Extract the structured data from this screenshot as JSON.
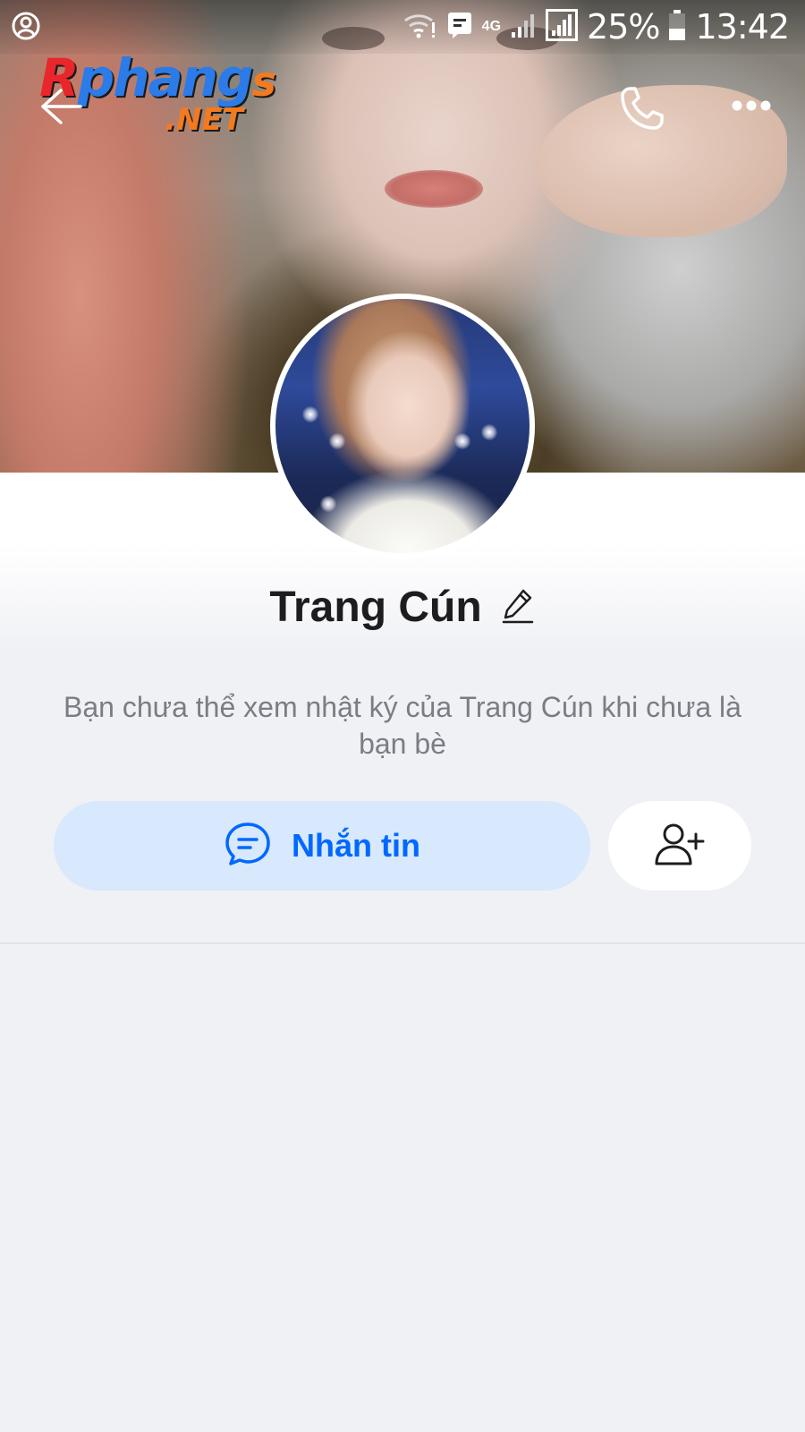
{
  "status_bar": {
    "network": "4G",
    "battery": "25%",
    "time": "13:42"
  },
  "watermark": {
    "text": "Rphangs",
    "sub": ".NET"
  },
  "header": {
    "back_icon": "arrow-left-icon",
    "call_icon": "phone-icon",
    "more_icon": "more-dots-icon"
  },
  "profile": {
    "name": "Trang Cún",
    "edit_icon": "pencil-icon",
    "note": "Bạn chưa thể xem nhật ký của Trang Cún khi chưa là bạn bè"
  },
  "actions": {
    "message_label": "Nhắn tin",
    "message_icon": "chat-bubble-icon",
    "add_friend_icon": "add-user-icon"
  },
  "colors": {
    "accent": "#0068ff",
    "accent_bg": "#d8e8fd",
    "background": "#f0f1f5"
  }
}
